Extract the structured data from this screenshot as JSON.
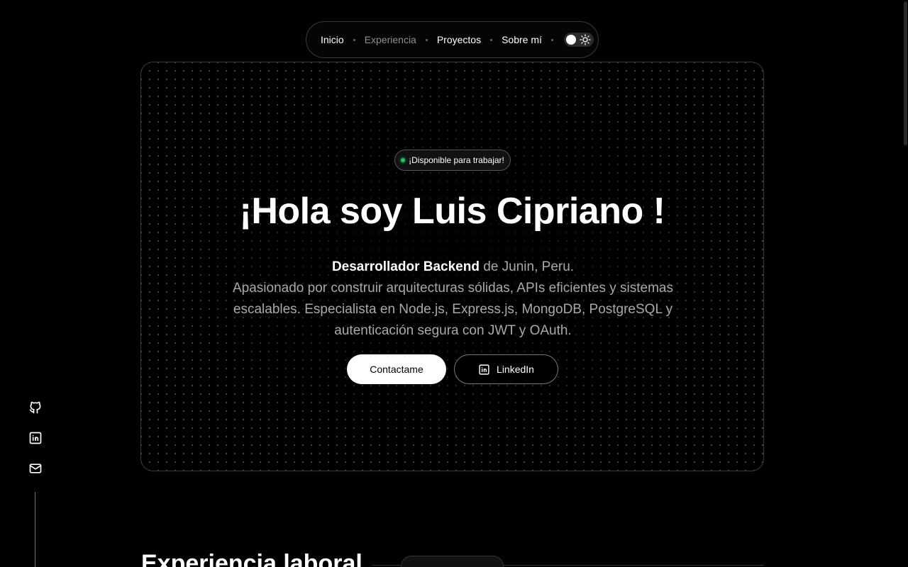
{
  "nav": {
    "items": [
      {
        "label": "Inicio",
        "active": false
      },
      {
        "label": "Experiencia",
        "active": true
      },
      {
        "label": "Proyectos",
        "active": false
      },
      {
        "label": "Sobre mí",
        "active": false
      }
    ],
    "theme_icon": "sun-icon"
  },
  "hero": {
    "badge": "¡Disponible para trabajar!",
    "badge_status_color": "#22c55e",
    "title": "¡Hola soy Luis Cipriano !",
    "role": "Desarrollador Backend",
    "location": "de Junin, Peru.",
    "description": "Apasionado por construir arquitecturas sólidas, APIs eficientes y sistemas escalables. Especialista en Node.js, Express.js, MongoDB, PostgreSQL y autenticación segura con JWT y OAuth.",
    "contact_label": "Contactame",
    "linkedin_label": "LinkedIn"
  },
  "social": {
    "icons": [
      "github-icon",
      "linkedin-icon",
      "mail-icon"
    ]
  },
  "section": {
    "title": "Experiencia laboral"
  },
  "colors": {
    "background": "#000000",
    "accent": "#ffffff",
    "muted_text": "#a9a9a9",
    "status": "#22c55e"
  }
}
